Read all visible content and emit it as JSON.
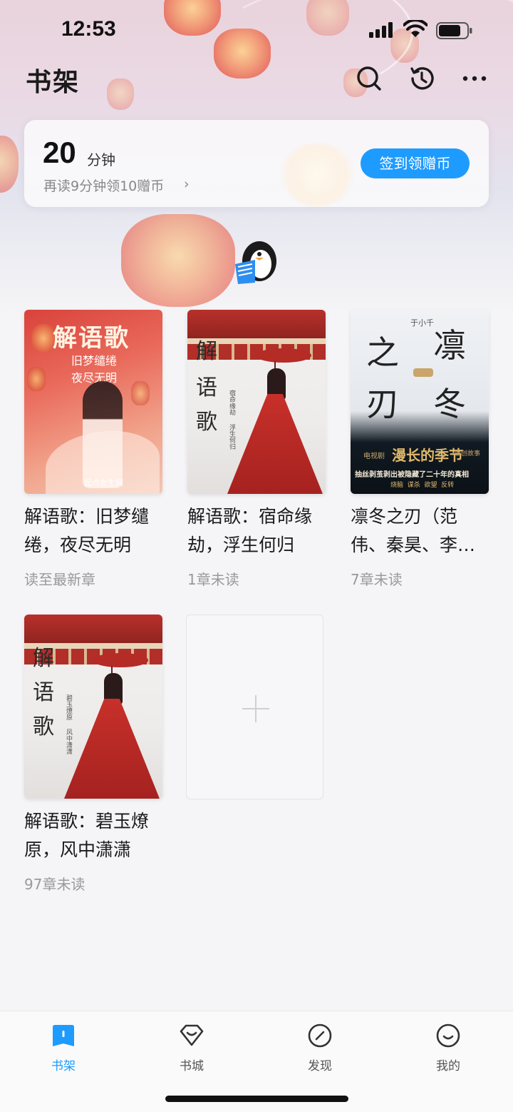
{
  "status_bar": {
    "time": "12:53"
  },
  "header": {
    "title": "书架",
    "icons": [
      "search-icon",
      "history-icon",
      "more-icon"
    ]
  },
  "reading": {
    "minutes": "20",
    "unit": "分钟",
    "hint": "再读9分钟领10赠币",
    "hint_arrow": "›",
    "checkin_label": "签到领赠币"
  },
  "books": [
    {
      "title": "解语歌：旧梦缱绻，夜尽无明",
      "status": "读至最新章",
      "cover": {
        "title": "解语歌",
        "lines": [
          "旧梦缱绻",
          "夜尽无明"
        ],
        "publisher": "起点女生网"
      }
    },
    {
      "title": "解语歌：宿命缘劫，浮生何归",
      "status": "1章未读",
      "cover": {
        "title": [
          "解",
          "语",
          "歌"
        ],
        "side_1": "宿命缘劫",
        "side_2": "浮生何归"
      }
    },
    {
      "title": "凛冬之刃（范伟、秦昊、李…",
      "status": "7章未读",
      "cover": {
        "author": "于小千",
        "chars": [
          "之",
          "凛",
          "刃",
          "冬"
        ],
        "banner": "漫长的季节",
        "tag_left": "电视剧",
        "tag_right": "原创故事",
        "tagline": "抽丝剥茧剥出被隐藏了二十年的真相",
        "keywords": "烧脑  谋杀  欲望  反转"
      }
    },
    {
      "title": "解语歌：碧玉燎原，风中潇潇",
      "status": "97章未读",
      "cover": {
        "title": [
          "解",
          "语",
          "歌"
        ],
        "side_1": "碧玉燎原",
        "side_2": "风中潇潇"
      }
    }
  ],
  "add_tile": {
    "symbol": "+"
  },
  "tabs": [
    {
      "label": "书架",
      "icon": "bookshelf-icon",
      "active": true
    },
    {
      "label": "书城",
      "icon": "bookstore-icon",
      "active": false
    },
    {
      "label": "发现",
      "icon": "discover-icon",
      "active": false
    },
    {
      "label": "我的",
      "icon": "profile-icon",
      "active": false
    }
  ],
  "colors": {
    "accent": "#1e9bff",
    "text": "#1a1a1a",
    "muted": "#999999",
    "cover_red": "#c9332d"
  }
}
